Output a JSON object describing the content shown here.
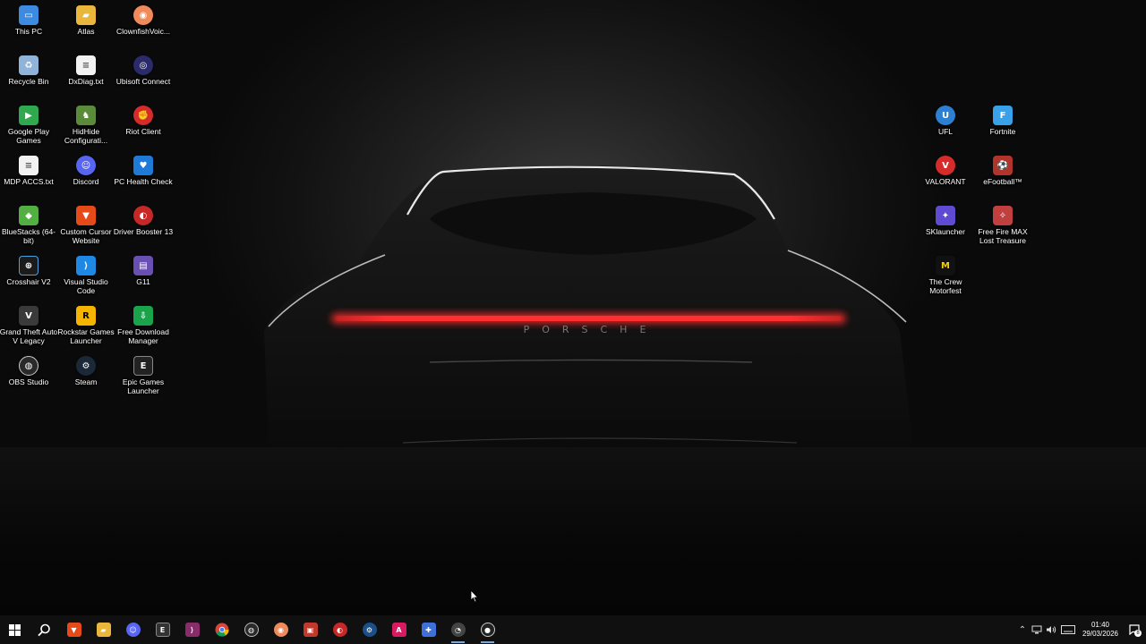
{
  "desktop": {
    "icons": [
      {
        "label": "This PC",
        "icon": "this-pc-icon",
        "color": "#3d8be0",
        "glyph": "▭"
      },
      {
        "label": "Atlas",
        "icon": "folder-icon",
        "color": "#e8b73c",
        "glyph": "▰"
      },
      {
        "label": "ClownfishVoic...",
        "icon": "clownfish-icon",
        "color": "#f08a5a",
        "glyph": "◉"
      },
      {
        "label": "Recycle Bin",
        "icon": "recycle-bin-icon",
        "color": "#8fb3d9",
        "glyph": "♻"
      },
      {
        "label": "DxDiag.txt",
        "icon": "text-file-icon",
        "color": "#f2f2f2",
        "glyph": "≡"
      },
      {
        "label": "Ubisoft Connect",
        "icon": "ubisoft-icon",
        "color": "#2b2b6b",
        "glyph": "◎"
      },
      {
        "label": "Google Play Games",
        "icon": "google-play-games-icon",
        "color": "#2fa84f",
        "glyph": "▶"
      },
      {
        "label": "HidHide Configurati...",
        "icon": "hidhide-icon",
        "color": "#5a8a3a",
        "glyph": "♞"
      },
      {
        "label": "Riot Client",
        "icon": "riot-client-icon",
        "color": "#d62b2b",
        "glyph": "✊"
      },
      {
        "label": "MDP ACCS.txt",
        "icon": "text-file-icon",
        "color": "#f2f2f2",
        "glyph": "≡"
      },
      {
        "label": "Discord",
        "icon": "discord-icon",
        "color": "#5865f2",
        "glyph": "☺"
      },
      {
        "label": "PC Health Check",
        "icon": "pc-health-check-icon",
        "color": "#1e7ad6",
        "glyph": "♥"
      },
      {
        "label": "BlueStacks (64-bit)",
        "icon": "bluestacks-icon",
        "color": "#52b043",
        "glyph": "◆"
      },
      {
        "label": "Custom Cursor Website",
        "icon": "brave-icon",
        "color": "#e64a19",
        "glyph": "▼"
      },
      {
        "label": "Driver Booster 13",
        "icon": "driver-booster-icon",
        "color": "#c62828",
        "glyph": "◐"
      },
      {
        "label": "Crosshair V2",
        "icon": "crosshair-icon",
        "color": "#1b1b1b",
        "glyph": "⊕"
      },
      {
        "label": "Visual Studio Code",
        "icon": "vscode-icon",
        "color": "#1e88e5",
        "glyph": "⟩"
      },
      {
        "label": "G11",
        "icon": "g11-icon",
        "color": "#6a4fb3",
        "glyph": "▤"
      },
      {
        "label": "Grand Theft Auto V Legacy",
        "icon": "gta-icon",
        "color": "#3a3a3a",
        "glyph": "V"
      },
      {
        "label": "Rockstar Games Launcher",
        "icon": "rockstar-icon",
        "color": "#f5b400",
        "glyph": "R"
      },
      {
        "label": "Free Download Manager",
        "icon": "fdm-icon",
        "color": "#1aa34a",
        "glyph": "⇩"
      },
      {
        "label": "OBS Studio",
        "icon": "obs-icon",
        "color": "#2a2a2a",
        "glyph": "◍"
      },
      {
        "label": "Steam",
        "icon": "steam-icon",
        "color": "#1b2838",
        "glyph": "⚙"
      },
      {
        "label": "Epic Games Launcher",
        "icon": "epic-games-icon",
        "color": "#222222",
        "glyph": "E"
      },
      {
        "label": "UFL",
        "icon": "ufl-icon",
        "color": "#2d7fd1",
        "glyph": "U"
      },
      {
        "label": "Fortnite",
        "icon": "fortnite-icon",
        "color": "#3aa0e8",
        "glyph": "F"
      },
      {
        "label": "VALORANT",
        "icon": "valorant-icon",
        "color": "#d62b2b",
        "glyph": "V"
      },
      {
        "label": "eFootball™",
        "icon": "efootball-icon",
        "color": "#b0342a",
        "glyph": "⚽"
      },
      {
        "label": "SKlauncher",
        "icon": "sklauncher-icon",
        "color": "#5e4bd1",
        "glyph": "✦"
      },
      {
        "label": "Free Fire MAX Lost Treasure",
        "icon": "free-fire-icon",
        "color": "#c04040",
        "glyph": "✧"
      },
      {
        "label": "The Crew Motorfest",
        "icon": "the-crew-icon",
        "color": "#111111",
        "glyph": "M"
      }
    ]
  },
  "taskbar": {
    "items": [
      {
        "name": "start",
        "icon": "windows-start-icon",
        "glyph": "⊞",
        "color": "transparent",
        "running": false
      },
      {
        "name": "search",
        "icon": "search-icon",
        "glyph": "⌕",
        "color": "transparent",
        "running": false
      },
      {
        "name": "brave",
        "icon": "brave-icon",
        "glyph": "▼",
        "color": "#e64a19",
        "running": false
      },
      {
        "name": "file-explorer",
        "icon": "file-explorer-icon",
        "glyph": "▰",
        "color": "#e8b73c",
        "running": false
      },
      {
        "name": "discord",
        "icon": "discord-icon",
        "glyph": "☺",
        "color": "#5865f2",
        "running": false
      },
      {
        "name": "epic-games",
        "icon": "epic-games-icon",
        "glyph": "E",
        "color": "#333333",
        "running": false
      },
      {
        "name": "visual-studio",
        "icon": "visual-studio-icon",
        "glyph": "⟩",
        "color": "#8a2b6b",
        "running": false
      },
      {
        "name": "chrome",
        "icon": "chrome-icon",
        "glyph": "◉",
        "color": "#34a853",
        "running": false
      },
      {
        "name": "obs",
        "icon": "obs-icon",
        "glyph": "◍",
        "color": "#2a2a2a",
        "running": false
      },
      {
        "name": "clownfish",
        "icon": "clownfish-icon",
        "glyph": "◉",
        "color": "#f08a5a",
        "running": false
      },
      {
        "name": "game-app",
        "icon": "game-app-icon",
        "glyph": "▣",
        "color": "#c0392b",
        "running": false
      },
      {
        "name": "driver-booster",
        "icon": "driver-booster-icon",
        "glyph": "◐",
        "color": "#c62828",
        "running": false
      },
      {
        "name": "steam",
        "icon": "steam-icon",
        "glyph": "⚙",
        "color": "#1b4f8a",
        "running": false
      },
      {
        "name": "anydesk",
        "icon": "anydesk-icon",
        "glyph": "A",
        "color": "#d81b60",
        "running": false
      },
      {
        "name": "gamepad",
        "icon": "gamepad-icon",
        "glyph": "✚",
        "color": "#3f6fd8",
        "running": false
      },
      {
        "name": "speedometer",
        "icon": "speedometer-icon",
        "glyph": "◔",
        "color": "#444444",
        "running": true
      },
      {
        "name": "record",
        "icon": "record-icon",
        "glyph": "●",
        "color": "#222222",
        "running": true
      }
    ]
  },
  "tray": {
    "chevron": "^",
    "time": "01:40",
    "date": "29/03/2026",
    "notification_count": "8"
  }
}
